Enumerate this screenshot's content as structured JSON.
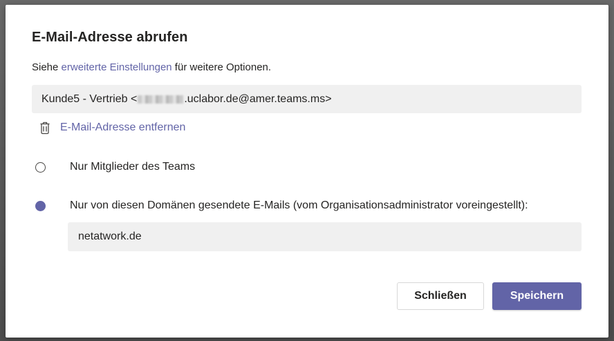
{
  "dialog": {
    "title": "E-Mail-Adresse abrufen",
    "subtitle_prefix": "Siehe ",
    "subtitle_link": "erweiterte Einstellungen",
    "subtitle_suffix": " für weitere Optionen.",
    "email_prefix": "Kunde5 - Vertrieb <",
    "email_suffix": ".uclabor.de@amer.teams.ms>",
    "remove_label": "E-Mail-Adresse entfernen",
    "options": [
      {
        "label": "Nur Mitglieder des Teams",
        "selected": false
      },
      {
        "label": "Nur von diesen Domänen gesendete E-Mails (vom Organisationsadministrator voreingestellt):",
        "selected": true
      }
    ],
    "domain_value": "netatwork.de",
    "close_label": "Schließen",
    "save_label": "Speichern"
  },
  "colors": {
    "accent": "#6264a7",
    "field_bg": "#f0f0f0",
    "text": "#252423"
  },
  "icons": {
    "remove": "trash-icon"
  }
}
